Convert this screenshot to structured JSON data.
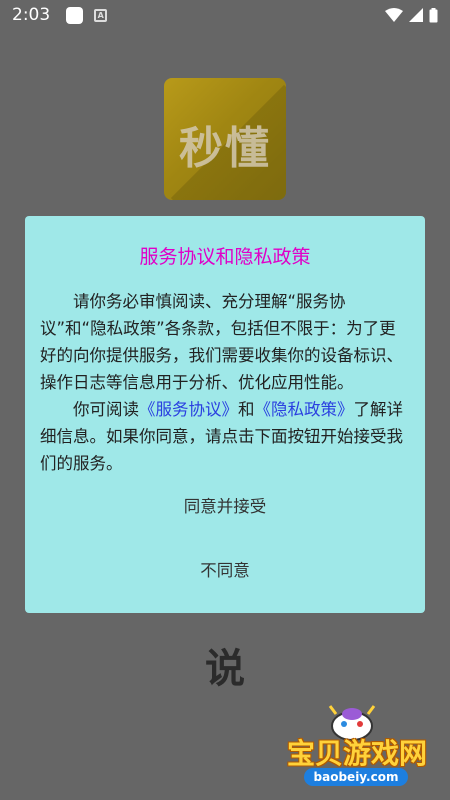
{
  "status_bar": {
    "time": "2:03"
  },
  "app_logo": {
    "text": "秒懂"
  },
  "dialog": {
    "title": "服务协议和隐私政策",
    "paragraph1": "请你务必审慎阅读、充分理解“服务协议”和“隐私政策”各条款，包括但不限于：为了更好的向你提供服务，我们需要收集你的设备标识、操作日志等信息用于分析、优化应用性能。",
    "paragraph2_prefix": "你可阅读",
    "service_link": "《服务协议》",
    "paragraph2_and": "和",
    "privacy_link": "《隐私政策》",
    "paragraph2_suffix": "了解详细信息。如果你同意，请点击下面按钮开始接受我们的服务。",
    "agree_label": "同意并接受",
    "disagree_label": "不同意"
  },
  "bottom_char": "说",
  "watermark": {
    "text": "宝贝游戏网",
    "url": "baobeiy.com"
  },
  "colors": {
    "background": "#666666",
    "dialog_bg": "#9fe8e8",
    "title": "#e000c8",
    "link": "#2a3fe0"
  }
}
